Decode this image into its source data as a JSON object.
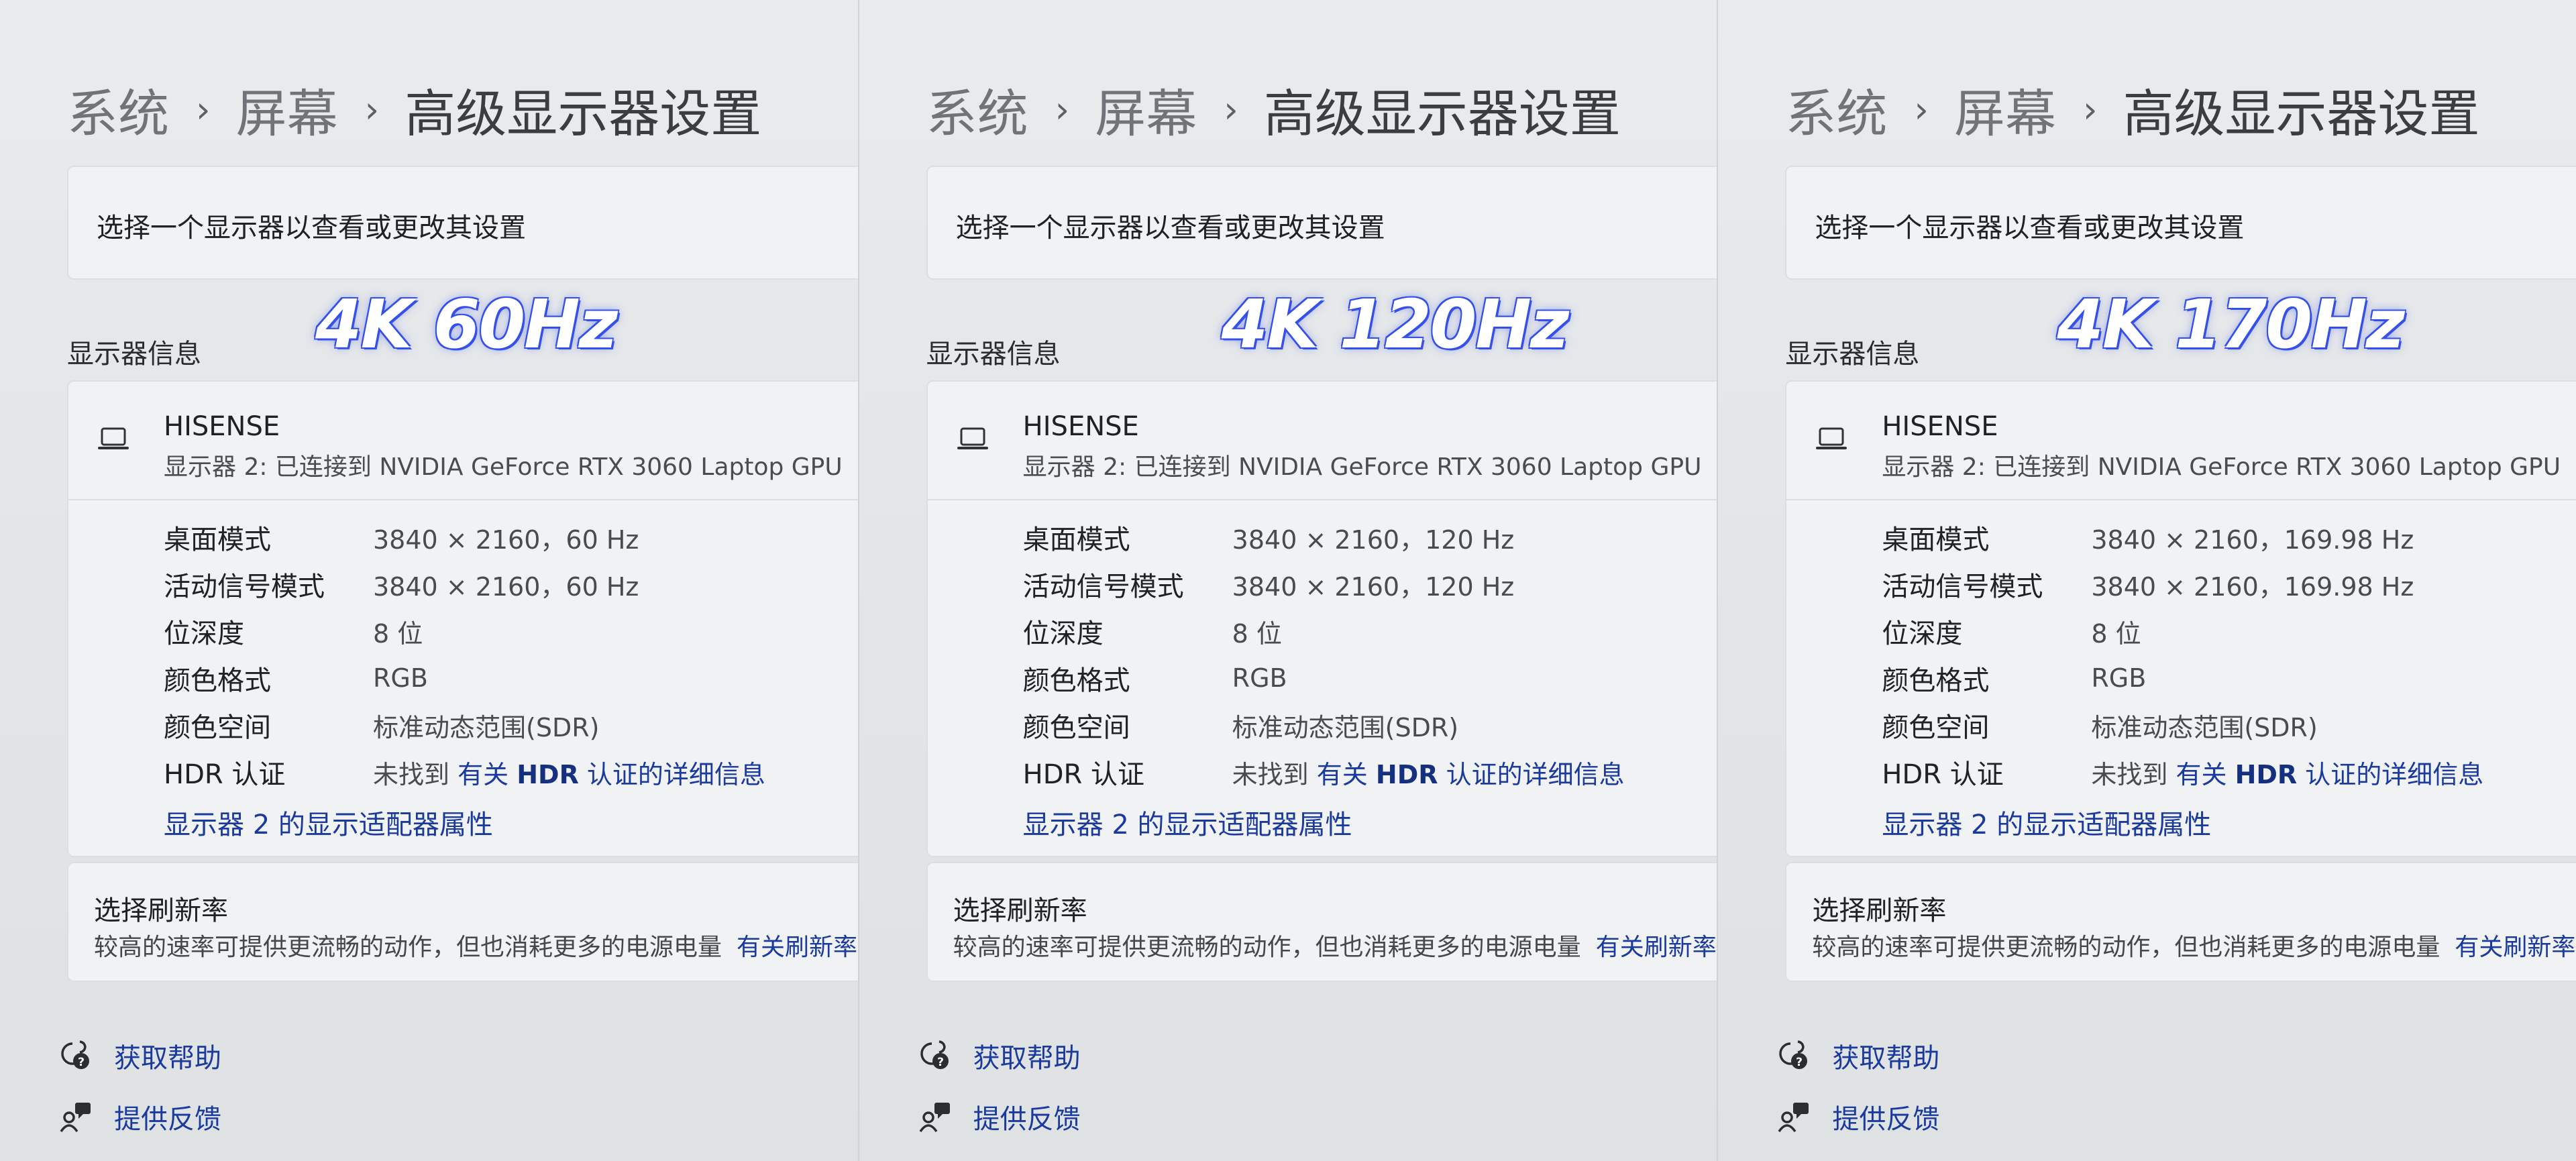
{
  "panels": [
    {
      "badge": "4K 60Hz",
      "breadcrumb": {
        "system": "系统",
        "display": "屏幕",
        "current": "高级显示器设置"
      },
      "select_display_text": "选择一个显示器以查看或更改其设置",
      "section_label": "显示器信息",
      "monitor": {
        "name": "HISENSE",
        "subtitle": "显示器 2: 已连接到 NVIDIA GeForce RTX 3060 Laptop GPU"
      },
      "info": {
        "desktop_mode": {
          "label": "桌面模式",
          "value": "3840 × 2160，60 Hz"
        },
        "active_signal": {
          "label": "活动信号模式",
          "value": "3840 × 2160，60 Hz"
        },
        "bit_depth": {
          "label": "位深度",
          "value": "8 位"
        },
        "color_format": {
          "label": "颜色格式",
          "value": "RGB"
        },
        "color_space": {
          "label": "颜色空间",
          "value": "标准动态范围(SDR)"
        },
        "hdr": {
          "label": "HDR 认证",
          "prefix": "未找到",
          "link_pre": "有关",
          "link_bold": "HDR",
          "link_post": "认证的详细信息"
        }
      },
      "adapter_link": "显示器 2 的显示适配器属性",
      "refresh": {
        "title": "选择刷新率",
        "desc": "较高的速率可提供更流畅的动作，但也消耗更多的电源电量",
        "link": "有关刷新率"
      },
      "footer": {
        "help": "获取帮助",
        "feedback": "提供反馈"
      }
    },
    {
      "badge": "4K 120Hz",
      "breadcrumb": {
        "system": "系统",
        "display": "屏幕",
        "current": "高级显示器设置"
      },
      "select_display_text": "选择一个显示器以查看或更改其设置",
      "section_label": "显示器信息",
      "monitor": {
        "name": "HISENSE",
        "subtitle": "显示器 2: 已连接到 NVIDIA GeForce RTX 3060 Laptop GPU"
      },
      "info": {
        "desktop_mode": {
          "label": "桌面模式",
          "value": "3840 × 2160，120 Hz"
        },
        "active_signal": {
          "label": "活动信号模式",
          "value": "3840 × 2160，120 Hz"
        },
        "bit_depth": {
          "label": "位深度",
          "value": "8 位"
        },
        "color_format": {
          "label": "颜色格式",
          "value": "RGB"
        },
        "color_space": {
          "label": "颜色空间",
          "value": "标准动态范围(SDR)"
        },
        "hdr": {
          "label": "HDR 认证",
          "prefix": "未找到",
          "link_pre": "有关",
          "link_bold": "HDR",
          "link_post": "认证的详细信息"
        }
      },
      "adapter_link": "显示器 2 的显示适配器属性",
      "refresh": {
        "title": "选择刷新率",
        "desc": "较高的速率可提供更流畅的动作，但也消耗更多的电源电量",
        "link": "有关刷新率"
      },
      "footer": {
        "help": "获取帮助",
        "feedback": "提供反馈"
      }
    },
    {
      "badge": "4K 170Hz",
      "breadcrumb": {
        "system": "系统",
        "display": "屏幕",
        "current": "高级显示器设置"
      },
      "select_display_text": "选择一个显示器以查看或更改其设置",
      "section_label": "显示器信息",
      "monitor": {
        "name": "HISENSE",
        "subtitle": "显示器 2: 已连接到 NVIDIA GeForce RTX 3060 Laptop GPU"
      },
      "info": {
        "desktop_mode": {
          "label": "桌面模式",
          "value": "3840 × 2160，169.98 Hz"
        },
        "active_signal": {
          "label": "活动信号模式",
          "value": "3840 × 2160，169.98 Hz"
        },
        "bit_depth": {
          "label": "位深度",
          "value": "8 位"
        },
        "color_format": {
          "label": "颜色格式",
          "value": "RGB"
        },
        "color_space": {
          "label": "颜色空间",
          "value": "标准动态范围(SDR)"
        },
        "hdr": {
          "label": "HDR 认证",
          "prefix": "未找到",
          "link_pre": "有关",
          "link_bold": "HDR",
          "link_post": "认证的详细信息"
        }
      },
      "adapter_link": "显示器 2 的显示适配器属性",
      "refresh": {
        "title": "选择刷新率",
        "desc": "较高的速率可提供更流畅的动作，但也消耗更多的电源电量",
        "link": "有关刷新率"
      },
      "footer": {
        "help": "获取帮助",
        "feedback": "提供反馈"
      }
    }
  ],
  "colors": {
    "link": "#1a3a9e",
    "badge_glow": "#3652ea",
    "card": "#f1f2f3"
  },
  "icons": [
    "laptop-icon",
    "help-icon",
    "feedback-icon",
    "chevron-right-icon"
  ]
}
